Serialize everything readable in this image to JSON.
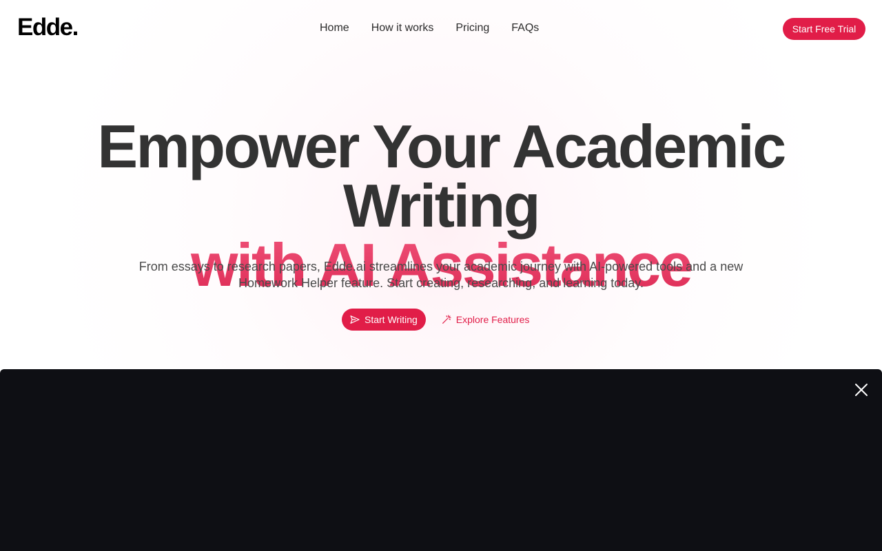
{
  "header": {
    "logo": "Edde.",
    "nav": [
      {
        "label": "Home"
      },
      {
        "label": "How it works"
      },
      {
        "label": "Pricing"
      },
      {
        "label": "FAQs"
      }
    ],
    "cta_label": "Start Free Trial"
  },
  "hero": {
    "title_line1": "Empower Your Academic Writing",
    "title_line2": "with AI Assistance",
    "subtitle_line1": "From essays to research papers, Edde.ai streamlines your academic journey with AI-powered tools and a new",
    "subtitle_line2": "Homework Helper feature. Start creating, researching, and learning today.",
    "primary_button": {
      "label": "Start Writing",
      "icon": "send-icon"
    },
    "secondary_button": {
      "label": "Explore Features",
      "icon": "magic-wand-icon"
    }
  },
  "video_panel": {
    "close_icon": "close-icon"
  },
  "colors": {
    "accent": "#e11d48",
    "title_dark": "#333333",
    "panel_bg": "#0e0f14"
  }
}
